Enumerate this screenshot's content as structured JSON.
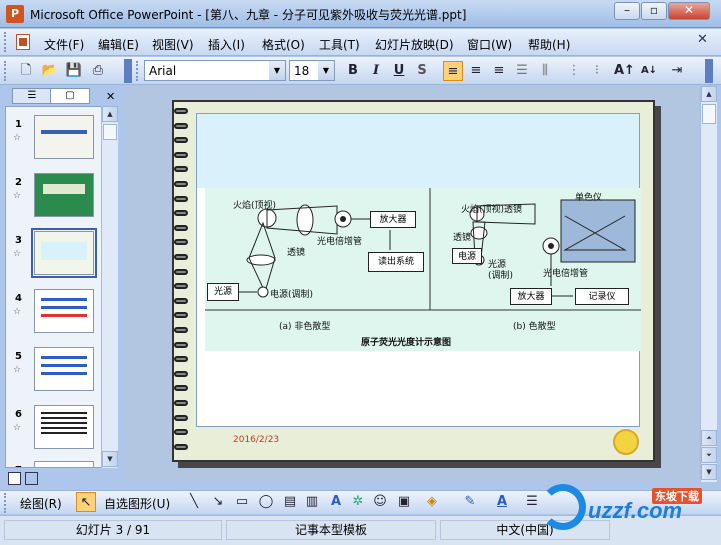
{
  "window": {
    "title": "Microsoft Office PowerPoint - [第八、九章 - 分子可见紫外吸收与荧光光谱.ppt]",
    "minimize": "–",
    "maximize": "▫",
    "close": "✕"
  },
  "menu": [
    "文件(F)",
    "编辑(E)",
    "视图(V)",
    "插入(I)",
    "格式(O)",
    "工具(T)",
    "幻灯片放映(D)",
    "窗口(W)",
    "帮助(H)"
  ],
  "toolbar": {
    "font": "Arial",
    "size": "18",
    "bold": "B",
    "italic": "I",
    "underline": "U",
    "shadow": "S"
  },
  "slides_pane": {
    "tab_outline": "☰",
    "tab_slides": "▢",
    "thumbnails": [
      {
        "num": "1"
      },
      {
        "num": "2"
      },
      {
        "num": "3"
      },
      {
        "num": "4"
      },
      {
        "num": "5"
      },
      {
        "num": "6"
      },
      {
        "num": "7"
      }
    ]
  },
  "slide": {
    "date": "2016/2/23",
    "figure_caption": "原子荧光光度计示意图",
    "left_label": "(a)  非色散型",
    "right_label": "(b)  色散型",
    "left": {
      "flame": "火焰(顶视)",
      "lens": "透镜",
      "pmt": "光电倍增管",
      "amp": "放大器",
      "readout": "读出系统",
      "source": "光源",
      "power": "电源(调制)"
    },
    "right": {
      "flame": "火焰(顶视)透镜",
      "mono": "单色仪",
      "lens": "透镜",
      "power": "电源",
      "source": "光源\n(调制)",
      "pmt": "光电倍增管",
      "amp": "放大器",
      "recorder": "记录仪"
    }
  },
  "drawbar": {
    "draw": "绘图(R)",
    "autoshape": "自选图形(U)"
  },
  "status": {
    "slide": "幻灯片 3 / 91",
    "template": "记事本型模板",
    "lang": "中文(中国)"
  },
  "watermark": {
    "text": "uzzf.com",
    "badge": "东坡下载"
  }
}
